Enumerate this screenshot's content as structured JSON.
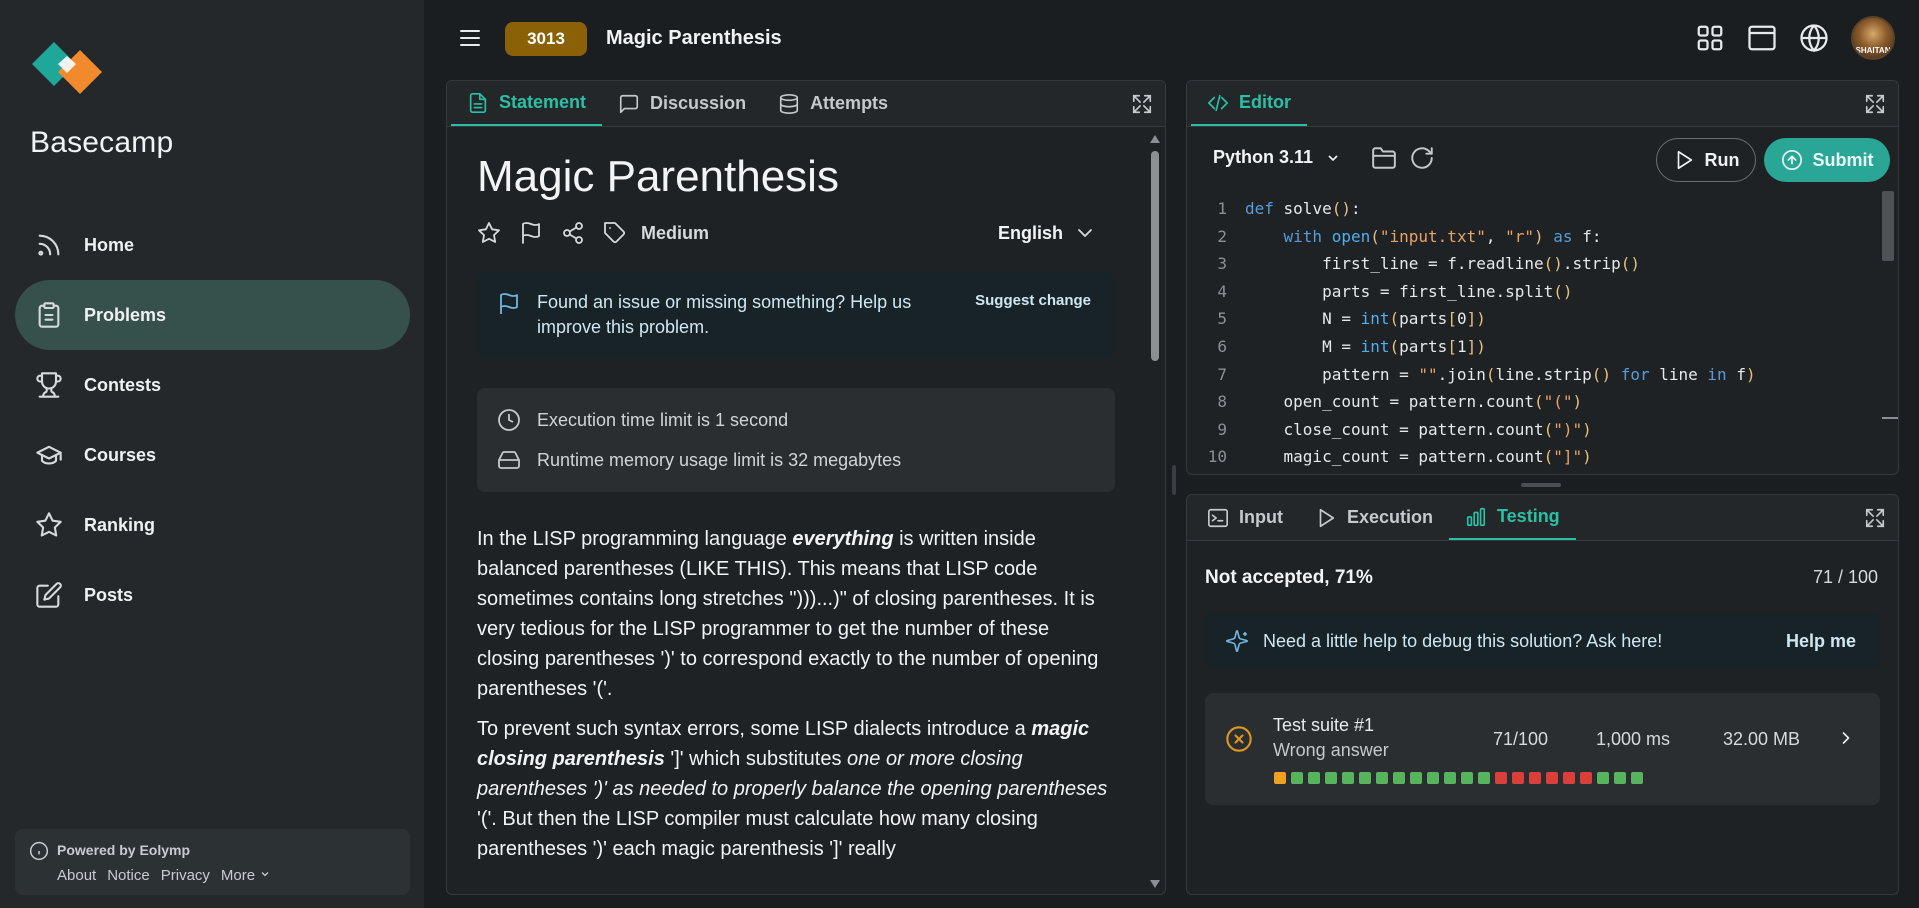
{
  "brand": {
    "name": "Basecamp"
  },
  "sidebar": {
    "items": [
      {
        "label": "Home",
        "icon": "rss-icon",
        "active": false
      },
      {
        "label": "Problems",
        "icon": "clipboard-icon",
        "active": true
      },
      {
        "label": "Contests",
        "icon": "trophy-icon",
        "active": false
      },
      {
        "label": "Courses",
        "icon": "graduation-cap-icon",
        "active": false
      },
      {
        "label": "Ranking",
        "icon": "star-icon",
        "active": false
      },
      {
        "label": "Posts",
        "icon": "edit-icon",
        "active": false
      }
    ],
    "footer": {
      "powered": "Powered by Eolymp",
      "links": [
        "About",
        "Notice",
        "Privacy",
        "More"
      ]
    }
  },
  "topbar": {
    "problem_id": "3013",
    "title": "Magic Parenthesis",
    "avatar_text": "SHAITAN"
  },
  "statement": {
    "tabs": [
      "Statement",
      "Discussion",
      "Attempts"
    ],
    "active_tab": "Statement",
    "title": "Magic Parenthesis",
    "difficulty": "Medium",
    "language": "English",
    "issue_text": "Found an issue or missing something? Help us improve this problem.",
    "suggest_label": "Suggest change",
    "time_limit": "Execution time limit is 1 second",
    "memory_limit": "Runtime memory usage limit is 32 megabytes",
    "p1": {
      "a": "In the LISP programming language ",
      "b": "everything",
      "c": " is written inside balanced parentheses (LIKE THIS). This means that LISP code sometimes contains long stretches \")))...)\" of closing parentheses. It is very tedious for the LISP programmer to get the number of these closing parentheses ')' to correspond exactly to the number of opening parentheses '('."
    },
    "p2": {
      "a": "To prevent such syntax errors, some LISP dialects introduce a ",
      "b": "magic closing parenthesis",
      "c": " ']' which substitutes ",
      "d": "one or more closing parentheses ')' as needed to properly balance the opening parentheses",
      "e": " '('. But then the LISP compiler must calculate how many closing parentheses ')' each magic parenthesis ']' really"
    }
  },
  "editor": {
    "tab": "Editor",
    "language": "Python 3.11",
    "run_label": "Run",
    "submit_label": "Submit",
    "code_lines": [
      "def solve():",
      "    with open(\"input.txt\", \"r\") as f:",
      "        first_line = f.readline().strip()",
      "        parts = first_line.split()",
      "        N = int(parts[0])",
      "        M = int(parts[1])",
      "        pattern = \"\".join(line.strip() for line in f)",
      "    open_count = pattern.count(\"(\")",
      "    close_count = pattern.count(\")\")",
      "    magic_count = pattern.count(\"]\")"
    ]
  },
  "testing": {
    "tabs": [
      "Input",
      "Execution",
      "Testing"
    ],
    "active_tab": "Testing",
    "result": "Not accepted, 71%",
    "score": "71 / 100",
    "help_text": "Need a little help to debug this solution? Ask here!",
    "help_button": "Help me",
    "suite": {
      "name": "Test suite #1",
      "status": "Wrong answer",
      "points": "71/100",
      "time": "1,000 ms",
      "memory": "32.00 MB",
      "tests": [
        "partial",
        "pass",
        "pass",
        "pass",
        "pass",
        "pass",
        "pass",
        "pass",
        "pass",
        "pass",
        "pass",
        "pass",
        "pass",
        "fail",
        "fail",
        "fail",
        "fail",
        "fail",
        "fail",
        "pass",
        "pass",
        "pass"
      ]
    }
  },
  "colors": {
    "accent": "#2bbfa5",
    "badge": "#8a6106",
    "pass": "#58b35d",
    "fail": "#d9403a",
    "partial": "#f0a020"
  }
}
